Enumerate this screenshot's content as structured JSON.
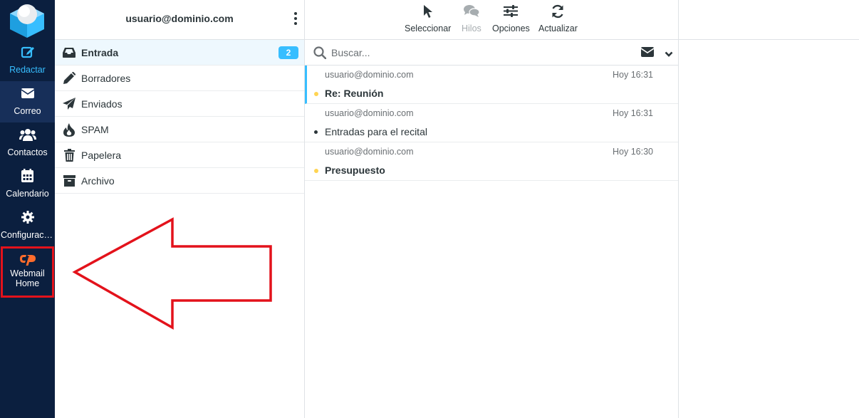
{
  "rail": {
    "compose_label": "Redactar",
    "mail_label": "Correo",
    "contacts_label": "Contactos",
    "calendar_label": "Calendario",
    "settings_label": "Configuración",
    "cpanel_label": "Webmail Home"
  },
  "folders": {
    "account": "usuario@dominio.com",
    "items": [
      {
        "label": "Entrada",
        "icon": "inbox-icon",
        "badge": "2"
      },
      {
        "label": "Borradores",
        "icon": "pencil-icon"
      },
      {
        "label": "Enviados",
        "icon": "paper-plane-icon"
      },
      {
        "label": "SPAM",
        "icon": "fire-icon"
      },
      {
        "label": "Papelera",
        "icon": "trash-icon"
      },
      {
        "label": "Archivo",
        "icon": "archive-icon"
      }
    ]
  },
  "toolbar": {
    "select_label": "Seleccionar",
    "threads_label": "Hilos",
    "options_label": "Opciones",
    "refresh_label": "Actualizar"
  },
  "search": {
    "placeholder": "Buscar..."
  },
  "messages": [
    {
      "from": "usuario@dominio.com",
      "date": "Hoy 16:31",
      "subject": "Re: Reunión",
      "unread": true,
      "flag": "yellow"
    },
    {
      "from": "usuario@dominio.com",
      "date": "Hoy 16:31",
      "subject": "Entradas para el recital",
      "unread": false,
      "flag": "none"
    },
    {
      "from": "usuario@dominio.com",
      "date": "Hoy 16:30",
      "subject": "Presupuesto",
      "unread": true,
      "flag": "yellow"
    }
  ],
  "colors": {
    "rail_bg": "#0b1f3f",
    "accent": "#37beff",
    "highlight_red": "#e3121b",
    "cpanel_orange": "#ff6c2c",
    "unread_dot": "#ffd452"
  }
}
